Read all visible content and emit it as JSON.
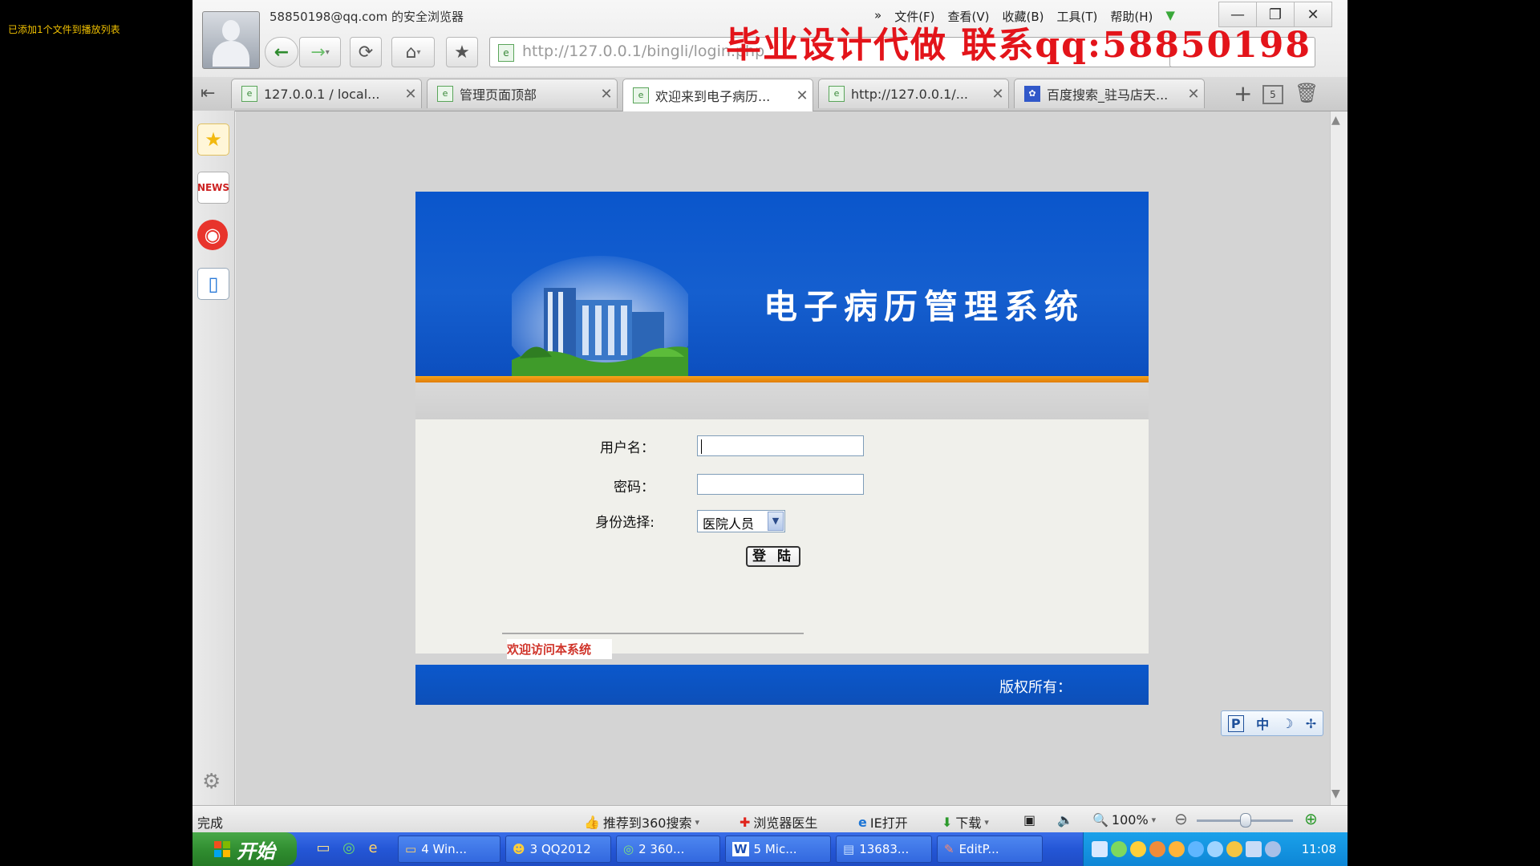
{
  "player": {
    "notice": "已添加1个文件到播放列表"
  },
  "browser": {
    "title": "58850198@qq.com 的安全浏览器",
    "menu": [
      "文件(F)",
      "查看(V)",
      "收藏(B)",
      "工具(T)",
      "帮助(H)"
    ],
    "menu_more": "»",
    "address": "http://127.0.0.1/bingli/login.php",
    "watermark": "毕业设计代做 联系qq:58850198",
    "tabs": [
      {
        "label": "127.0.0.1 / local...",
        "active": false,
        "icon": "page-icon"
      },
      {
        "label": "管理页面顶部",
        "active": false,
        "icon": "page-icon"
      },
      {
        "label": "欢迎来到电子病历...",
        "active": true,
        "icon": "page-icon"
      },
      {
        "label": "http://127.0.0.1/...",
        "active": false,
        "icon": "page-icon"
      },
      {
        "label": "百度搜索_驻马店天...",
        "active": false,
        "icon": "baidu-paw-icon"
      }
    ],
    "tab_count": "5",
    "status": {
      "text": "完成",
      "recommend": "推荐到360搜索",
      "doctor": "浏览器医生",
      "ie_open": "IE打开",
      "download": "下载",
      "zoom": "100%"
    }
  },
  "login": {
    "system_title": "电子病历管理系统",
    "username_label": "用户名：",
    "password_label": "密码：",
    "role_label": "身份选择:",
    "role_value": "医院人员",
    "login_button": "登 陆",
    "welcome": "欢迎访问本系统",
    "copyright": "版权所有："
  },
  "ime": {
    "items": [
      "P",
      "中",
      "☽",
      "✢"
    ]
  },
  "taskbar": {
    "start": "开始",
    "items": [
      {
        "label": "4 Win...",
        "icon": "folder-icon"
      },
      {
        "label": "3 QQ2012",
        "icon": "qq-penguin-icon"
      },
      {
        "label": "2 360...",
        "icon": "360-icon"
      },
      {
        "label": "5 Mic...",
        "icon": "word-icon"
      },
      {
        "label": "13683...",
        "icon": "document-icon"
      },
      {
        "label": "EditP...",
        "icon": "editplus-icon"
      }
    ],
    "clock": "11:08"
  },
  "colors": {
    "banner_blue": "#155fcf",
    "orange_stripe": "#f6a51a",
    "watermark_red": "#e3141a",
    "welcome_red": "#d0342a",
    "taskbar_blue": "#2456d6",
    "start_green": "#2f8c2f"
  }
}
